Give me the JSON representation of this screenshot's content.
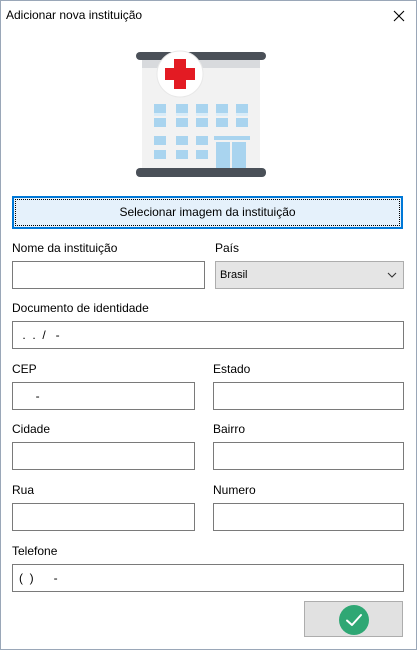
{
  "window": {
    "title": "Adicionar nova instituição"
  },
  "icons": {
    "close": "close-icon",
    "hospital": "hospital-building-icon",
    "dropdown": "chevron-down-icon",
    "confirm": "checkmark-circle-icon"
  },
  "colors": {
    "select_button_bg": "#e5f1fb",
    "select_button_border": "#0078d7",
    "confirm_green": "#2fa774",
    "hospital_red": "#e31b23"
  },
  "form": {
    "select_image_label": "Selecionar imagem da instituição",
    "nome_label": "Nome da instituição",
    "nome_value": "",
    "pais_label": "País",
    "pais_value": "Brasil",
    "documento_label": "Documento de identidade",
    "documento_value": " .  .  /   -",
    "cep_label": "CEP",
    "cep_value": "     -",
    "estado_label": "Estado",
    "estado_value": "",
    "cidade_label": "Cidade",
    "cidade_value": "",
    "bairro_label": "Bairro",
    "bairro_value": "",
    "rua_label": "Rua",
    "rua_value": "",
    "numero_label": "Numero",
    "numero_value": "",
    "telefone_label": "Telefone",
    "telefone_value": "(  )      -"
  }
}
